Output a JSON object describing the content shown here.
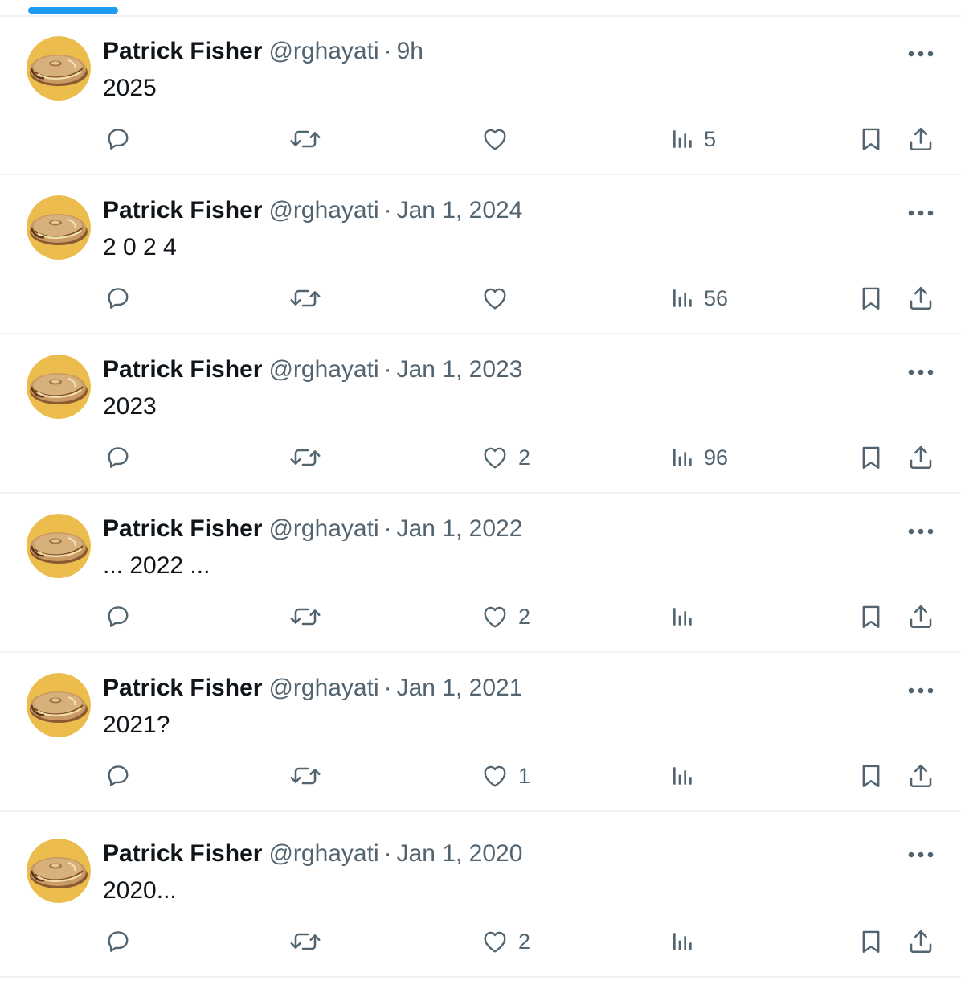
{
  "colors": {
    "accent": "#1d9bf0",
    "text": "#0f1419",
    "muted": "#536471",
    "divider": "#eff3f4",
    "avatar_bg": "#ecbc4c"
  },
  "icons": {
    "reply": "reply-icon",
    "retweet": "retweet-icon",
    "like": "heart-icon",
    "views": "views-icon",
    "bookmark": "bookmark-icon",
    "share": "share-icon",
    "more": "more-icon"
  },
  "tweets": [
    {
      "name": "Patrick Fisher",
      "handle": "@rghayati",
      "sep": "·",
      "time": "9h",
      "text": "2025",
      "likes": "",
      "views": "5"
    },
    {
      "name": "Patrick Fisher",
      "handle": "@rghayati",
      "sep": "·",
      "time": "Jan 1, 2024",
      "text": "2 0 2 4",
      "likes": "",
      "views": "56"
    },
    {
      "name": "Patrick Fisher",
      "handle": "@rghayati",
      "sep": "·",
      "time": "Jan 1, 2023",
      "text": "2023",
      "likes": "2",
      "views": "96"
    },
    {
      "name": "Patrick Fisher",
      "handle": "@rghayati",
      "sep": "·",
      "time": "Jan 1, 2022",
      "text": "... 2022 ...",
      "likes": "2",
      "views": ""
    },
    {
      "name": "Patrick Fisher",
      "handle": "@rghayati",
      "sep": "·",
      "time": "Jan 1, 2021",
      "text": "2021?",
      "likes": "1",
      "views": ""
    },
    {
      "name": "Patrick Fisher",
      "handle": "@rghayati",
      "sep": "·",
      "time": "Jan 1, 2020",
      "text": "2020...",
      "likes": "2",
      "views": ""
    }
  ]
}
